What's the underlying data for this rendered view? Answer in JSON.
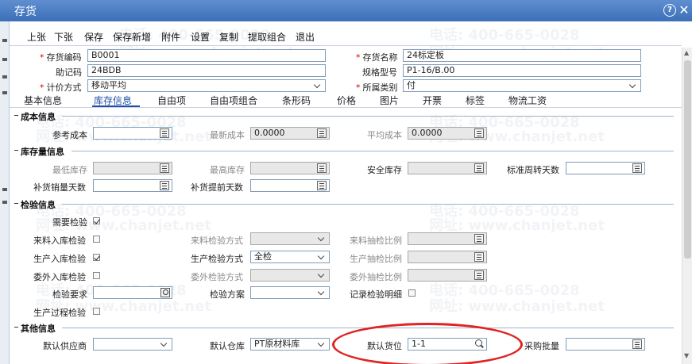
{
  "window": {
    "title": "存货"
  },
  "toolbar": {
    "items": [
      "上张",
      "下张",
      "保存",
      "保存新增",
      "附件",
      "设置",
      "复制",
      "提取组合",
      "退出"
    ]
  },
  "header": {
    "code_label": "存货编码",
    "code_value": "B0001",
    "name_label": "存货名称",
    "name_value": "24标定板",
    "mnemonic_label": "助记码",
    "mnemonic_value": "24BDB",
    "spec_label": "规格型号",
    "spec_value": "P1-16/B.00",
    "costing_label": "计价方式",
    "costing_value": "移动平均",
    "category_label": "所属类别",
    "category_value": "付"
  },
  "tabs": [
    "基本信息",
    "库存信息",
    "自由项",
    "自由项组合",
    "条形码",
    "价格",
    "图片",
    "开票",
    "标签",
    "物流工资"
  ],
  "sections": {
    "cost": "成本信息",
    "stock": "库存量信息",
    "inspect": "检验信息",
    "other": "其他信息"
  },
  "cost": {
    "ref_label": "参考成本",
    "ref_value": "",
    "latest_label": "最新成本",
    "latest_value": "0.0000",
    "avg_label": "平均成本",
    "avg_value": "0.0000"
  },
  "stock": {
    "min_label": "最低库存",
    "max_label": "最高库存",
    "safe_label": "安全库存",
    "turnover_label": "标准周转天数",
    "replenish_qty_label": "补货销量天数",
    "replenish_lead_label": "补货提前天数"
  },
  "inspect": {
    "need_label": "需要检验",
    "incoming_label": "来料入库检验",
    "incoming_method_label": "来料检验方式",
    "incoming_ratio_label": "来料抽检比例",
    "production_label": "生产入库检验",
    "production_method_label": "生产检验方式",
    "production_method_value": "全检",
    "production_ratio_label": "生产抽检比例",
    "outsource_label": "委外入库检验",
    "outsource_method_label": "委外检验方式",
    "outsource_ratio_label": "委外抽检比例",
    "requirement_label": "检验要求",
    "plan_label": "检验方案",
    "record_label": "记录检验明细",
    "process_label": "生产过程检验"
  },
  "other": {
    "supplier_label": "默认供应商",
    "warehouse_label": "默认仓库",
    "warehouse_value": "PT原材料库",
    "location_label": "默认货位",
    "location_value": "1-1",
    "batch_label": "采购批量"
  },
  "watermarks": {
    "phone": "电话: 400-665-0028",
    "site": "网址: www.chanjet.net"
  },
  "colors": {
    "titlebar": "#3c6fb8",
    "active_tab": "#1f4fa8",
    "highlight": "#e02424",
    "required": "#dd0000"
  }
}
